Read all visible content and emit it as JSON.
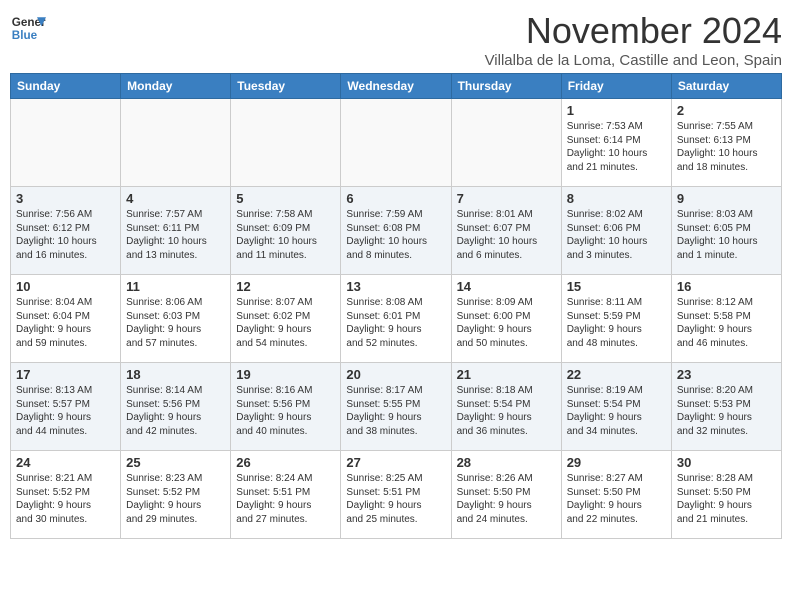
{
  "header": {
    "logo_line1": "General",
    "logo_line2": "Blue",
    "month": "November 2024",
    "location": "Villalba de la Loma, Castille and Leon, Spain"
  },
  "weekdays": [
    "Sunday",
    "Monday",
    "Tuesday",
    "Wednesday",
    "Thursday",
    "Friday",
    "Saturday"
  ],
  "weeks": [
    [
      {
        "day": "",
        "info": ""
      },
      {
        "day": "",
        "info": ""
      },
      {
        "day": "",
        "info": ""
      },
      {
        "day": "",
        "info": ""
      },
      {
        "day": "",
        "info": ""
      },
      {
        "day": "1",
        "info": "Sunrise: 7:53 AM\nSunset: 6:14 PM\nDaylight: 10 hours\nand 21 minutes."
      },
      {
        "day": "2",
        "info": "Sunrise: 7:55 AM\nSunset: 6:13 PM\nDaylight: 10 hours\nand 18 minutes."
      }
    ],
    [
      {
        "day": "3",
        "info": "Sunrise: 7:56 AM\nSunset: 6:12 PM\nDaylight: 10 hours\nand 16 minutes."
      },
      {
        "day": "4",
        "info": "Sunrise: 7:57 AM\nSunset: 6:11 PM\nDaylight: 10 hours\nand 13 minutes."
      },
      {
        "day": "5",
        "info": "Sunrise: 7:58 AM\nSunset: 6:09 PM\nDaylight: 10 hours\nand 11 minutes."
      },
      {
        "day": "6",
        "info": "Sunrise: 7:59 AM\nSunset: 6:08 PM\nDaylight: 10 hours\nand 8 minutes."
      },
      {
        "day": "7",
        "info": "Sunrise: 8:01 AM\nSunset: 6:07 PM\nDaylight: 10 hours\nand 6 minutes."
      },
      {
        "day": "8",
        "info": "Sunrise: 8:02 AM\nSunset: 6:06 PM\nDaylight: 10 hours\nand 3 minutes."
      },
      {
        "day": "9",
        "info": "Sunrise: 8:03 AM\nSunset: 6:05 PM\nDaylight: 10 hours\nand 1 minute."
      }
    ],
    [
      {
        "day": "10",
        "info": "Sunrise: 8:04 AM\nSunset: 6:04 PM\nDaylight: 9 hours\nand 59 minutes."
      },
      {
        "day": "11",
        "info": "Sunrise: 8:06 AM\nSunset: 6:03 PM\nDaylight: 9 hours\nand 57 minutes."
      },
      {
        "day": "12",
        "info": "Sunrise: 8:07 AM\nSunset: 6:02 PM\nDaylight: 9 hours\nand 54 minutes."
      },
      {
        "day": "13",
        "info": "Sunrise: 8:08 AM\nSunset: 6:01 PM\nDaylight: 9 hours\nand 52 minutes."
      },
      {
        "day": "14",
        "info": "Sunrise: 8:09 AM\nSunset: 6:00 PM\nDaylight: 9 hours\nand 50 minutes."
      },
      {
        "day": "15",
        "info": "Sunrise: 8:11 AM\nSunset: 5:59 PM\nDaylight: 9 hours\nand 48 minutes."
      },
      {
        "day": "16",
        "info": "Sunrise: 8:12 AM\nSunset: 5:58 PM\nDaylight: 9 hours\nand 46 minutes."
      }
    ],
    [
      {
        "day": "17",
        "info": "Sunrise: 8:13 AM\nSunset: 5:57 PM\nDaylight: 9 hours\nand 44 minutes."
      },
      {
        "day": "18",
        "info": "Sunrise: 8:14 AM\nSunset: 5:56 PM\nDaylight: 9 hours\nand 42 minutes."
      },
      {
        "day": "19",
        "info": "Sunrise: 8:16 AM\nSunset: 5:56 PM\nDaylight: 9 hours\nand 40 minutes."
      },
      {
        "day": "20",
        "info": "Sunrise: 8:17 AM\nSunset: 5:55 PM\nDaylight: 9 hours\nand 38 minutes."
      },
      {
        "day": "21",
        "info": "Sunrise: 8:18 AM\nSunset: 5:54 PM\nDaylight: 9 hours\nand 36 minutes."
      },
      {
        "day": "22",
        "info": "Sunrise: 8:19 AM\nSunset: 5:54 PM\nDaylight: 9 hours\nand 34 minutes."
      },
      {
        "day": "23",
        "info": "Sunrise: 8:20 AM\nSunset: 5:53 PM\nDaylight: 9 hours\nand 32 minutes."
      }
    ],
    [
      {
        "day": "24",
        "info": "Sunrise: 8:21 AM\nSunset: 5:52 PM\nDaylight: 9 hours\nand 30 minutes."
      },
      {
        "day": "25",
        "info": "Sunrise: 8:23 AM\nSunset: 5:52 PM\nDaylight: 9 hours\nand 29 minutes."
      },
      {
        "day": "26",
        "info": "Sunrise: 8:24 AM\nSunset: 5:51 PM\nDaylight: 9 hours\nand 27 minutes."
      },
      {
        "day": "27",
        "info": "Sunrise: 8:25 AM\nSunset: 5:51 PM\nDaylight: 9 hours\nand 25 minutes."
      },
      {
        "day": "28",
        "info": "Sunrise: 8:26 AM\nSunset: 5:50 PM\nDaylight: 9 hours\nand 24 minutes."
      },
      {
        "day": "29",
        "info": "Sunrise: 8:27 AM\nSunset: 5:50 PM\nDaylight: 9 hours\nand 22 minutes."
      },
      {
        "day": "30",
        "info": "Sunrise: 8:28 AM\nSunset: 5:50 PM\nDaylight: 9 hours\nand 21 minutes."
      }
    ]
  ]
}
